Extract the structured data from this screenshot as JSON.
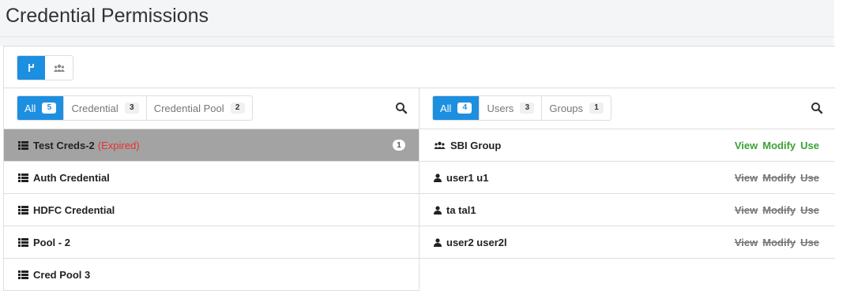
{
  "page": {
    "title": "Credential Permissions"
  },
  "credential_panel": {
    "tabs": [
      {
        "label": "All",
        "count": "5"
      },
      {
        "label": "Credential",
        "count": "3"
      },
      {
        "label": "Credential Pool",
        "count": "2"
      }
    ],
    "items": [
      {
        "name": "Test Creds-2",
        "status": "(Expired)",
        "count": "1"
      },
      {
        "name": "Auth Credential"
      },
      {
        "name": "HDFC Credential"
      },
      {
        "name": "Pool - 2"
      },
      {
        "name": "Cred Pool 3"
      }
    ]
  },
  "principal_panel": {
    "tabs": [
      {
        "label": "All",
        "count": "4"
      },
      {
        "label": "Users",
        "count": "3"
      },
      {
        "label": "Groups",
        "count": "1"
      }
    ],
    "items": [
      {
        "name": "SBI Group",
        "view": "View",
        "modify": "Modify",
        "use": "Use"
      },
      {
        "name": "user1 u1",
        "view": "View",
        "modify": "Modify",
        "use": "Use"
      },
      {
        "name": "ta tal1",
        "view": "View",
        "modify": "Modify",
        "use": "Use"
      },
      {
        "name": "user2 user2l",
        "view": "View",
        "modify": "Modify",
        "use": "Use"
      }
    ]
  },
  "icons": {
    "view_toggle_active": "fork-icon",
    "view_toggle_inactive": "group-icon",
    "search": "search-icon",
    "list": "list-icon",
    "group": "group-icon",
    "user": "user-icon"
  },
  "colors": {
    "accent": "#1d8fe0",
    "granted": "#3aa335",
    "expired": "#e5322d",
    "selected_row": "#a3a3a3"
  }
}
